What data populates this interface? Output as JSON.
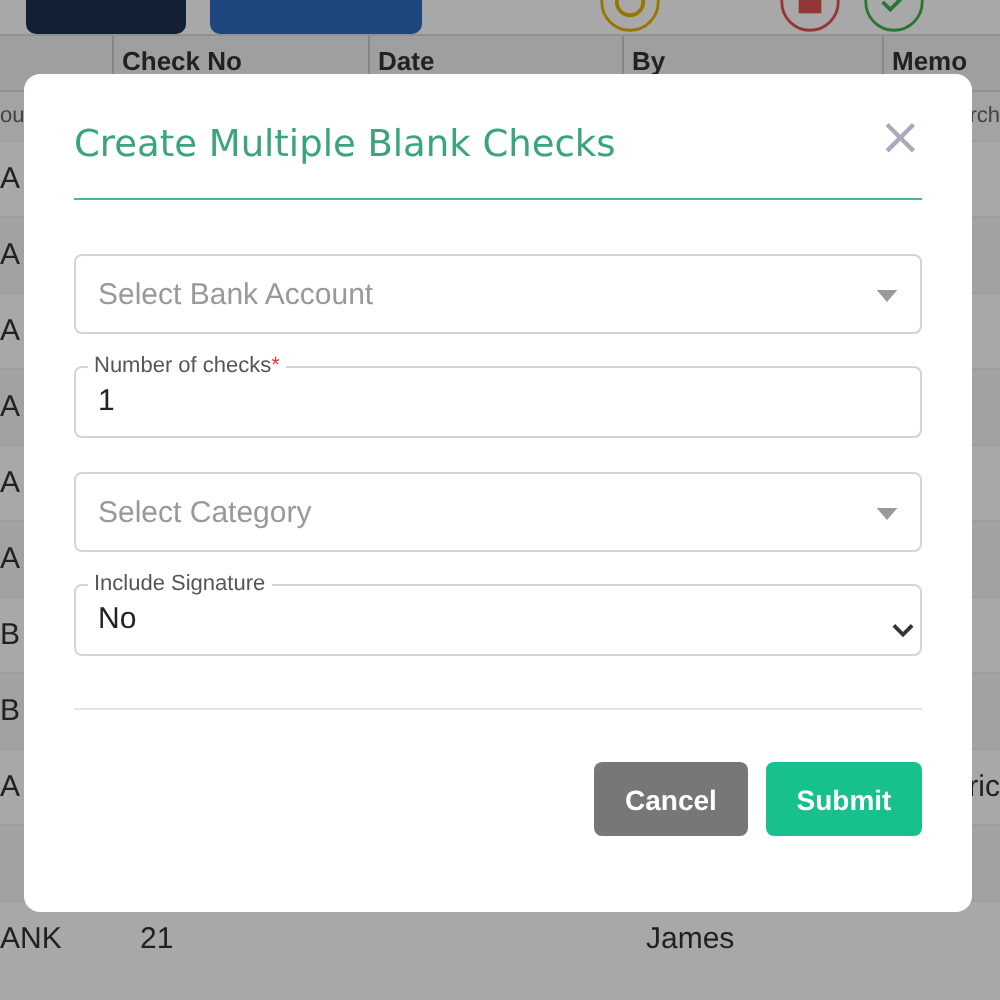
{
  "table": {
    "columns": [
      {
        "label": "Check No"
      },
      {
        "label": "Date"
      },
      {
        "label": "By"
      },
      {
        "label": "Memo"
      }
    ],
    "filter_row": {
      "column_1": "ou",
      "memo": "rch"
    },
    "rows": [
      {
        "column_1": "A"
      },
      {
        "column_1": "A"
      },
      {
        "column_1": "A"
      },
      {
        "column_1": "A"
      },
      {
        "column_1": "A"
      },
      {
        "column_1": "A"
      },
      {
        "column_1": "B"
      },
      {
        "column_1": "B"
      },
      {
        "column_1": "A",
        "memo": "ric"
      },
      {},
      {
        "column_1": "ANK",
        "check_no": "21",
        "by": "James"
      }
    ]
  },
  "dialog": {
    "title": "Create Multiple Blank Checks",
    "close": "×",
    "fields": [
      {
        "kind": "dropdown",
        "placeholder": "Select Bank Account"
      },
      {
        "kind": "number",
        "label": "Number of checks",
        "required_mark": "*",
        "value": "1"
      },
      {
        "kind": "dropdown",
        "placeholder": "Select Category"
      },
      {
        "kind": "select",
        "label": "Include Signature",
        "value": "No"
      }
    ],
    "buttons": [
      {
        "kind": "secondary",
        "label": "Cancel"
      },
      {
        "kind": "primary",
        "label": "Submit"
      }
    ]
  }
}
